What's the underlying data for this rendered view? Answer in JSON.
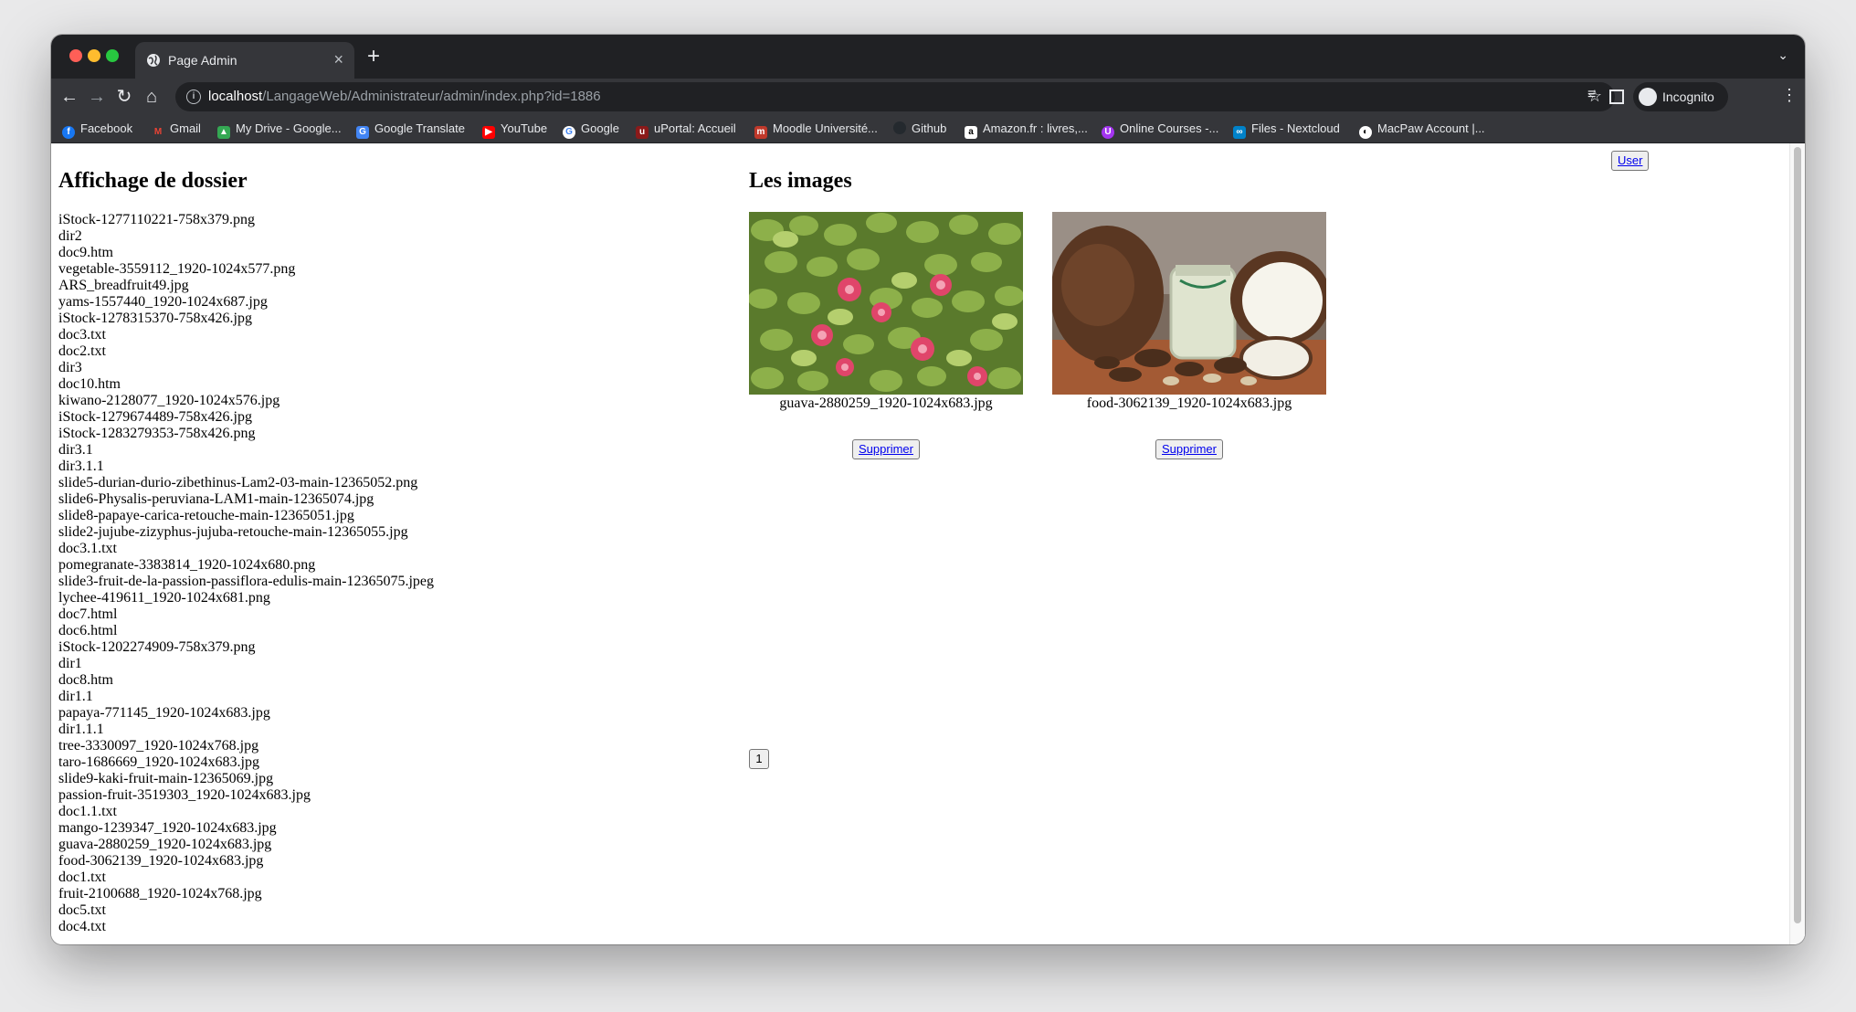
{
  "browser": {
    "tab_title": "Page Admin",
    "url_host": "localhost",
    "url_path": "/LangageWeb/Administrateur/admin/index.php?id=1886",
    "profile_label": "Incognito",
    "bookmarks": [
      {
        "label": "Facebook",
        "icon": "facebook-icon",
        "color": "#1877f2"
      },
      {
        "label": "Gmail",
        "icon": "gmail-icon",
        "color": "#ea4335"
      },
      {
        "label": "My Drive - Google...",
        "icon": "drive-icon",
        "color": "#34a853"
      },
      {
        "label": "Google Translate",
        "icon": "translate-icon",
        "color": "#4285f4"
      },
      {
        "label": "YouTube",
        "icon": "youtube-icon",
        "color": "#ff0000"
      },
      {
        "label": "Google",
        "icon": "google-icon",
        "color": "#ffffff"
      },
      {
        "label": "uPortal: Accueil",
        "icon": "uportal-icon",
        "color": "#8b1a1a"
      },
      {
        "label": "Moodle Université...",
        "icon": "moodle-icon",
        "color": "#c0392b"
      },
      {
        "label": "Github",
        "icon": "github-icon",
        "color": "#24292e"
      },
      {
        "label": "Amazon.fr : livres,...",
        "icon": "amazon-icon",
        "color": "#ffffff"
      },
      {
        "label": "Online Courses -...",
        "icon": "udemy-icon",
        "color": "#a435f0"
      },
      {
        "label": "Files - Nextcloud",
        "icon": "nextcloud-icon",
        "color": "#0082c9"
      },
      {
        "label": "MacPaw Account |...",
        "icon": "macpaw-icon",
        "color": "#ffffff"
      }
    ]
  },
  "page": {
    "user_button": "User",
    "files_heading": "Affichage de dossier",
    "images_heading": "Les images",
    "files": [
      "iStock-1277110221-758x379.png",
      "dir2",
      "doc9.htm",
      "vegetable-3559112_1920-1024x577.png",
      "ARS_breadfruit49.jpg",
      "yams-1557440_1920-1024x687.jpg",
      "iStock-1278315370-758x426.jpg",
      "doc3.txt",
      "doc2.txt",
      "dir3",
      "doc10.htm",
      "kiwano-2128077_1920-1024x576.jpg",
      "iStock-1279674489-758x426.jpg",
      "iStock-1283279353-758x426.png",
      "dir3.1",
      "dir3.1.1",
      "slide5-durian-durio-zibethinus-Lam2-03-main-12365052.png",
      "slide6-Physalis-peruviana-LAM1-main-12365074.jpg",
      "slide8-papaye-carica-retouche-main-12365051.jpg",
      "slide2-jujube-zizyphus-jujuba-retouche-main-12365055.jpg",
      "doc3.1.txt",
      "pomegranate-3383814_1920-1024x680.png",
      "slide3-fruit-de-la-passion-passiflora-edulis-main-12365075.jpeg",
      "lychee-419611_1920-1024x681.png",
      "doc7.html",
      "doc6.html",
      "iStock-1202274909-758x379.png",
      "dir1",
      "doc8.htm",
      "dir1.1",
      "papaya-771145_1920-1024x683.jpg",
      "dir1.1.1",
      "tree-3330097_1920-1024x768.jpg",
      "taro-1686669_1920-1024x683.jpg",
      "slide9-kaki-fruit-main-12365069.jpg",
      "passion-fruit-3519303_1920-1024x683.jpg",
      "doc1.1.txt",
      "mango-1239347_1920-1024x683.jpg",
      "guava-2880259_1920-1024x683.jpg",
      "food-3062139_1920-1024x683.jpg",
      "doc1.txt",
      "fruit-2100688_1920-1024x768.jpg",
      "doc5.txt",
      "doc4.txt"
    ],
    "images": [
      {
        "caption": "guava-2880259_1920-1024x683.jpg",
        "delete_label": "Supprimer"
      },
      {
        "caption": "food-3062139_1920-1024x683.jpg",
        "delete_label": "Supprimer"
      }
    ],
    "pagination": [
      "1"
    ]
  }
}
